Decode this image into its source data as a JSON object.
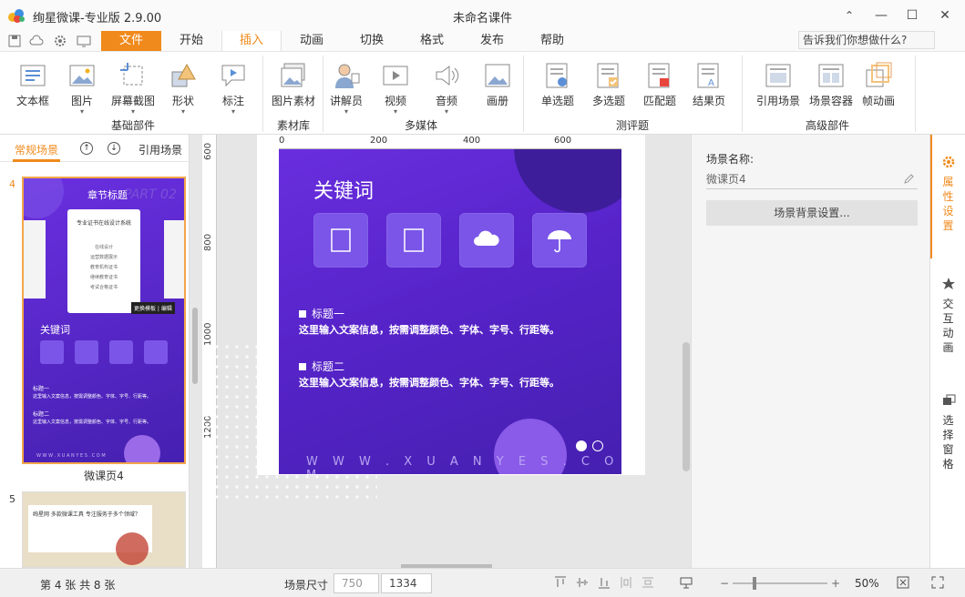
{
  "app": {
    "title": "绚星微课-专业版 2.9.00",
    "doc_title": "未命名课件"
  },
  "window": {
    "minimize": "—",
    "maximize": "☐",
    "close": "✕",
    "restore": "⌃"
  },
  "menu": {
    "tabs": [
      "文件",
      "开始",
      "插入",
      "动画",
      "切换",
      "格式",
      "发布",
      "帮助"
    ],
    "active": "插入",
    "tell_me": "告诉我们你想做什么?"
  },
  "ribbon": {
    "groups": [
      {
        "label": "基础部件",
        "items": [
          "文本框",
          "图片",
          "屏幕截图",
          "形状",
          "标注"
        ]
      },
      {
        "label": "素材库",
        "items": [
          "图片素材"
        ]
      },
      {
        "label": "多媒体",
        "items": [
          "讲解员",
          "视频",
          "音频",
          "画册"
        ]
      },
      {
        "label": "测评题",
        "items": [
          "单选题",
          "多选题",
          "匹配题",
          "结果页"
        ]
      },
      {
        "label": "高级部件",
        "items": [
          "引用场景",
          "场景容器",
          "帧动画"
        ]
      }
    ]
  },
  "left_pane": {
    "tab_normal": "常规场景",
    "tab_cite": "引用场景",
    "up": "↑",
    "down": "↓",
    "thumbs": [
      {
        "num": "4",
        "label": "微课页4",
        "mini": {
          "title": "章节标题",
          "bg_text": "PART 02",
          "card_title": "专业证书在线设计系统",
          "card_lines": [
            "在线设计",
            "运营数据展示",
            "教育机构证书",
            "继续教育证书",
            "考试合格证书"
          ],
          "card_tag": "更换模板 | 编辑",
          "kw": "关键词",
          "h1": "标题一",
          "t1": "这里输入文案信息，按需调整颜色、字体、字号、行距等。",
          "h2": "标题二",
          "t2": "这里输入文案信息，按需调整颜色、字体、字号、行距等。",
          "wm": "W W W . X U A N Y E S . C O M"
        }
      },
      {
        "num": "5",
        "label": "",
        "mini": {
          "text": "绚星网 多款微课工具 专注服务于多个领域？"
        }
      }
    ]
  },
  "canvas": {
    "ruler_top": [
      "0",
      "200",
      "400",
      "600"
    ],
    "ruler_left": [
      "600",
      "800",
      "1000",
      "1200"
    ],
    "slide": {
      "keyword_title": "关键词",
      "h1": "标题一",
      "t1": "这里输入文案信息，按需调整颜色、字体、字号、行距等。",
      "h2": "标题二",
      "t2": "这里输入文案信息，按需调整颜色、字体、字号、行距等。",
      "watermark": "W W W . X U A N Y E S . C O M"
    }
  },
  "props": {
    "scene_name_label": "场景名称:",
    "scene_name_value": "微课页4",
    "bg_button": "场景背景设置..."
  },
  "side_tabs": [
    {
      "label": "属性设置",
      "active": true
    },
    {
      "label": "交互动画",
      "active": false
    },
    {
      "label": "选择窗格",
      "active": false
    }
  ],
  "status": {
    "page_info": "第 4 张  共 8 张",
    "scene_size_label": "场景尺寸",
    "width": "750",
    "height": "1334",
    "zoom": "50%"
  },
  "colors": {
    "accent": "#f08a1c",
    "slide_purple": "#5a24cc"
  }
}
